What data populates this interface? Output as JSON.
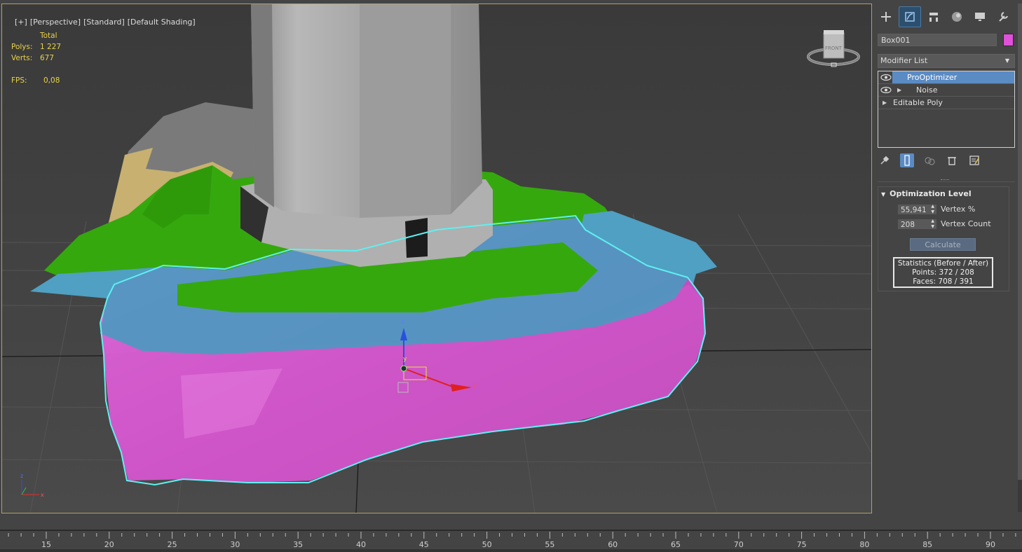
{
  "viewport": {
    "labels": [
      "[+]",
      "[Perspective]",
      "[Standard]",
      "[Default Shading]"
    ],
    "stats": {
      "header": "Total",
      "polys_label": "Polys:",
      "polys_value": "1 227",
      "verts_label": "Verts:",
      "verts_value": "677",
      "fps_label": "FPS:",
      "fps_value": "0,08"
    },
    "viewcube_face": "FRONT",
    "gizmo": {
      "z": "z",
      "y": "y",
      "x": "x"
    }
  },
  "command_panel": {
    "tabs": [
      {
        "icon": "create-icon"
      },
      {
        "icon": "modify-icon"
      },
      {
        "icon": "hierarchy-icon"
      },
      {
        "icon": "motion-icon"
      },
      {
        "icon": "display-icon"
      },
      {
        "icon": "utilities-icon"
      }
    ],
    "object_name": "Box001",
    "object_color": "#e050d8",
    "modifier_list_label": "Modifier List",
    "stack": [
      {
        "label": "ProOptimizer",
        "selected": true
      },
      {
        "label": "Noise",
        "selected": false
      },
      {
        "label": "Editable Poly",
        "selected": false
      }
    ],
    "optimization": {
      "title": "Optimization Level",
      "vertex_percent_value": "55,941",
      "vertex_percent_label": "Vertex %",
      "vertex_count_value": "208",
      "vertex_count_label": "Vertex Count",
      "calculate_label": "Calculate",
      "stats_title": "Statistics (Before / After)",
      "stats_points": "Points: 372 / 208",
      "stats_faces": "Faces: 708 / 391"
    }
  },
  "timeline": {
    "labels": [
      "15",
      "20",
      "25",
      "30",
      "35",
      "40",
      "45",
      "50",
      "55",
      "60",
      "65",
      "70",
      "75",
      "80",
      "85",
      "90"
    ]
  },
  "colors": {
    "selection_outline": "#5ff0f0",
    "viewport_border": "#b5a060",
    "stats_text": "#e8d24a",
    "accent": "#5b8bc3"
  }
}
